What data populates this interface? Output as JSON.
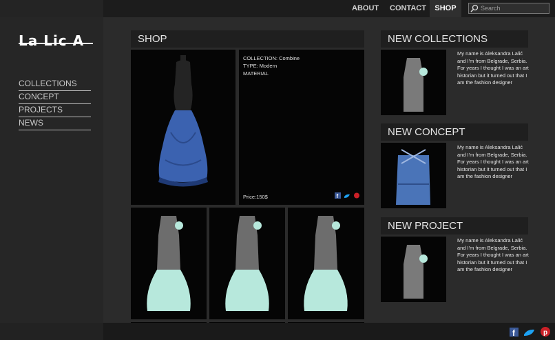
{
  "nav": {
    "about": "ABOUT",
    "contact": "CONTACT",
    "shop": "SHOP",
    "search_placeholder": "Search"
  },
  "logo": "La Lic A",
  "sidebar": {
    "items": [
      "COLLECTIONS",
      "CONCEPT",
      "PROJECTS",
      "NEWS"
    ]
  },
  "shop": {
    "title": "SHOP",
    "collection": "COLLECTION: Combine",
    "type": "TYPE: Modern",
    "material": "MATERIAL",
    "price": "Price:150$"
  },
  "right": {
    "new_collections": "NEW COLLECTIONS",
    "new_concept": "NEW CONCEPT",
    "new_project": "NEW PROJECT",
    "bio": "My name is Aleksandra Lalić and I'm from Belgrade, Serbia. For years I thought I was an art historian but it turned out that I am the fashion designer"
  },
  "colors": {
    "accent_blue": "#3b62b0",
    "mint": "#b7e8dc",
    "facebook": "#3b5998",
    "twitter": "#1da1f2",
    "pinterest": "#cb2027"
  },
  "icons": [
    "search-icon",
    "facebook-icon",
    "twitter-icon",
    "pinterest-icon"
  ]
}
